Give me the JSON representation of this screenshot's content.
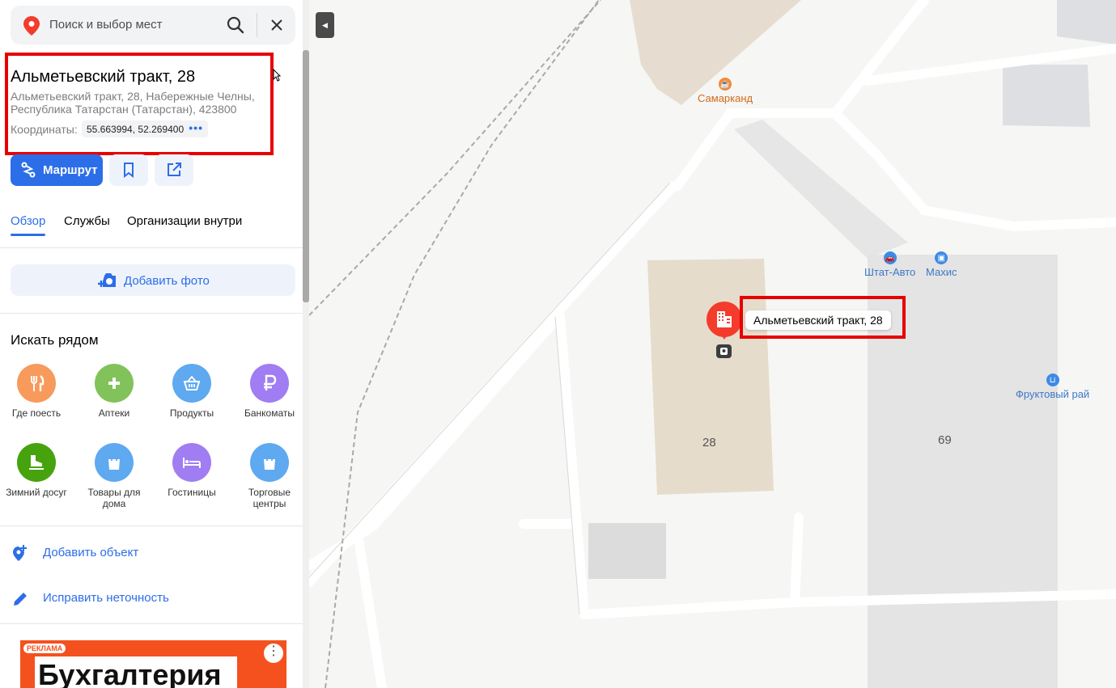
{
  "search": {
    "placeholder": "Поиск и выбор мест"
  },
  "place": {
    "title": "Альметьевский тракт, 28",
    "address": "Альметьевский тракт, 28, Набережные Челны, Республика Татарстан (Татарстан), 423800",
    "coords_label": "Координаты:",
    "coords_value": "55.663994, 52.269400"
  },
  "actions": {
    "route_label": "Маршрут"
  },
  "tabs": [
    {
      "label": "Обзор"
    },
    {
      "label": "Службы"
    },
    {
      "label": "Организации внутри"
    }
  ],
  "add_photo_label": "Добавить фото",
  "nearby": {
    "title": "Искать рядом",
    "items": [
      {
        "label": "Где поесть",
        "icon": "fork-knife-icon",
        "color": "#f79a5b"
      },
      {
        "label": "Аптеки",
        "icon": "plus-icon",
        "color": "#82c25a"
      },
      {
        "label": "Продукты",
        "icon": "basket-icon",
        "color": "#5ea9f0"
      },
      {
        "label": "Банкоматы",
        "icon": "ruble-icon",
        "color": "#a07df2"
      },
      {
        "label": "Зимний досуг",
        "icon": "skate-icon",
        "color": "#46a30d"
      },
      {
        "label": "Товары для дома",
        "icon": "bag-icon",
        "color": "#5ea9f0"
      },
      {
        "label": "Гостиницы",
        "icon": "bed-icon",
        "color": "#a07df2"
      },
      {
        "label": "Торговые центры",
        "icon": "bag-icon",
        "color": "#5ea9f0"
      }
    ]
  },
  "links": {
    "add_object": "Добавить объект",
    "fix_error": "Исправить неточность"
  },
  "ad": {
    "tag": "РЕКЛАМА",
    "headline": "Бухгалтерия"
  },
  "map": {
    "pois": [
      {
        "label": "Самарканд",
        "color": "#f08a3a",
        "icon": "cafe-icon"
      },
      {
        "label": "Штат-Авто",
        "color": "#3c8ae6",
        "icon": "car-icon"
      },
      {
        "label": "Махис",
        "color": "#3c8ae6",
        "icon": "bag-icon"
      },
      {
        "label": "Фруктовый рай",
        "color": "#3c8ae6",
        "icon": "basket-icon"
      }
    ],
    "house_numbers": [
      "28",
      "69"
    ],
    "selected_label": "Альметьевский тракт, 28"
  },
  "colors": {
    "accent": "#2c6ee8",
    "highlight": "#e80000",
    "marker": "#f43b2c"
  }
}
